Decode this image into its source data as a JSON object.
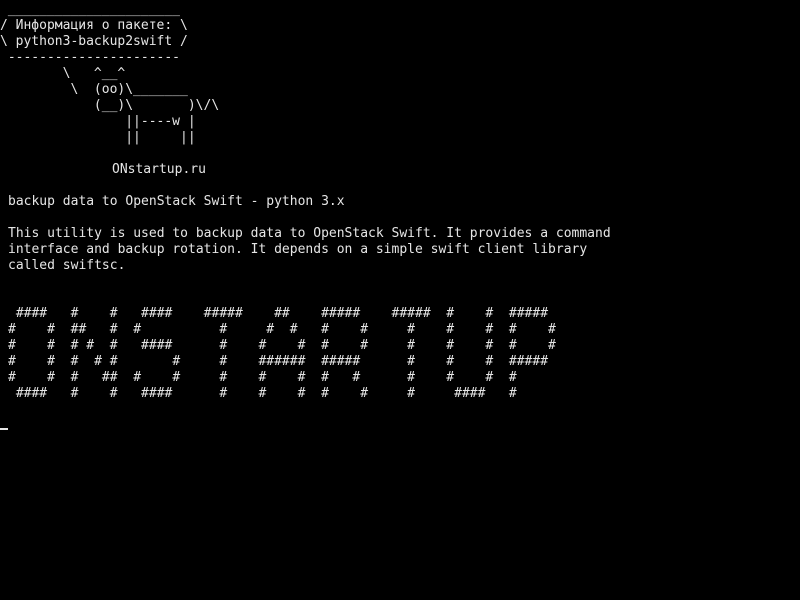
{
  "terminal": {
    "cowsay": [
      " ______________________",
      "/ Информация о пакете: \\",
      "\\ python3-backup2swift /",
      " ----------------------",
      "        \\   ^__^",
      "         \\  (oo)\\_______",
      "            (__)\\       )\\/\\",
      "                ||----w |",
      "                ||     ||"
    ],
    "site": "ONstartup.ru",
    "summary": "backup data to OpenStack Swift - python 3.x",
    "description": [
      "This utility is used to backup data to OpenStack Swift. It provides a command",
      "interface and backup rotation. It depends on a simple swift client library",
      "called swiftsc."
    ],
    "banner": [
      " ####   #    #   ####    #####    ##    #####    #####  #    #  #####",
      "#    #  ##   #  #          #     #  #   #    #     #    #    #  #    #",
      "#    #  # #  #   ####      #    #    #  #    #     #    #    #  #    #",
      "#    #  #  # #       #     #    ######  #####      #    #    #  #####",
      "#    #  #   ##  #    #     #    #    #  #   #      #    #    #  #",
      " ####   #    #   ####      #    #    #  #    #     #     ####   #"
    ]
  },
  "colors": {
    "background": "#000000",
    "text": "#e6e6e6"
  }
}
